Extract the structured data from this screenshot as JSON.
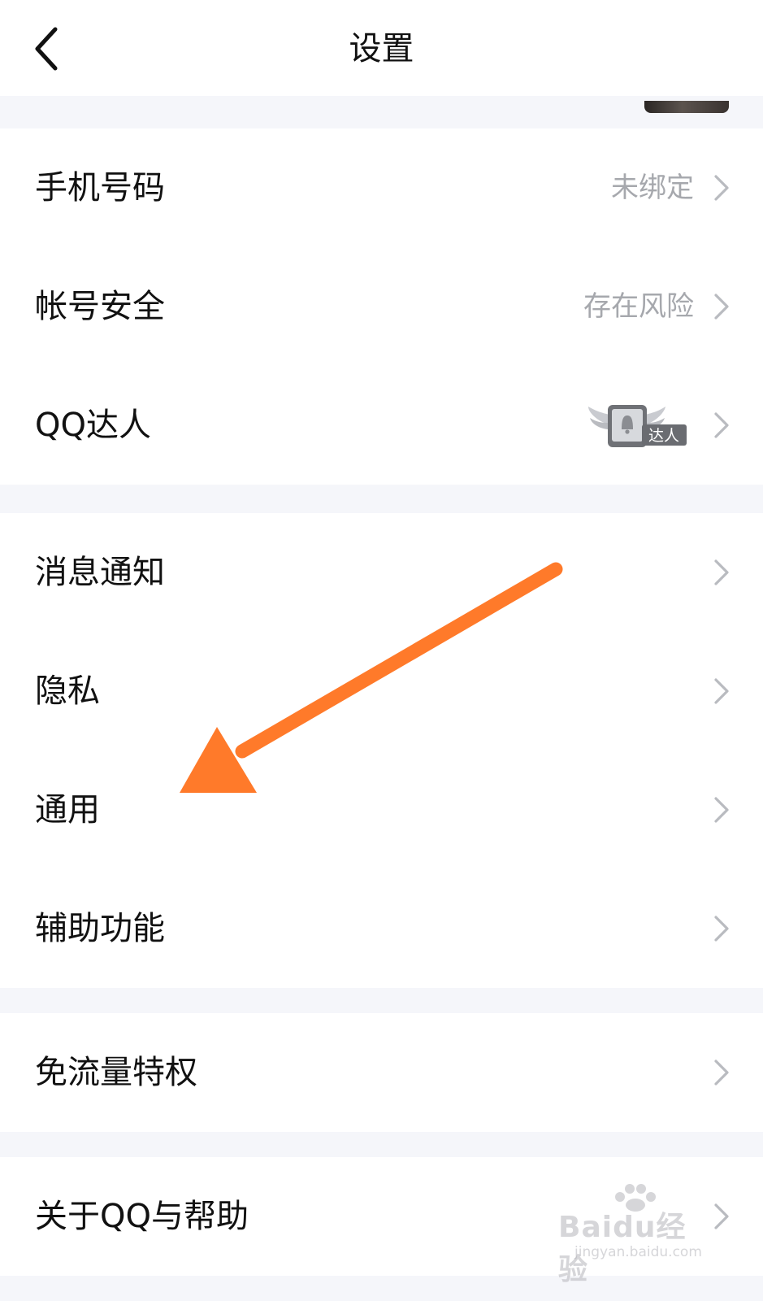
{
  "header": {
    "title": "设置"
  },
  "groups": [
    {
      "items": [
        {
          "label": "手机号码",
          "value": "未绑定"
        },
        {
          "label": "帐号安全",
          "value": "存在风险"
        },
        {
          "label": "QQ达人",
          "badge_text": "达人"
        }
      ]
    },
    {
      "items": [
        {
          "label": "消息通知"
        },
        {
          "label": "隐私"
        },
        {
          "label": "通用"
        },
        {
          "label": "辅助功能"
        }
      ]
    },
    {
      "items": [
        {
          "label": "免流量特权"
        }
      ]
    },
    {
      "items": [
        {
          "label": "关于QQ与帮助"
        }
      ]
    }
  ],
  "annotation": {
    "color": "#ff7a2a"
  },
  "watermark": {
    "main": "Baidu经验",
    "sub": "jingyan.baidu.com"
  }
}
